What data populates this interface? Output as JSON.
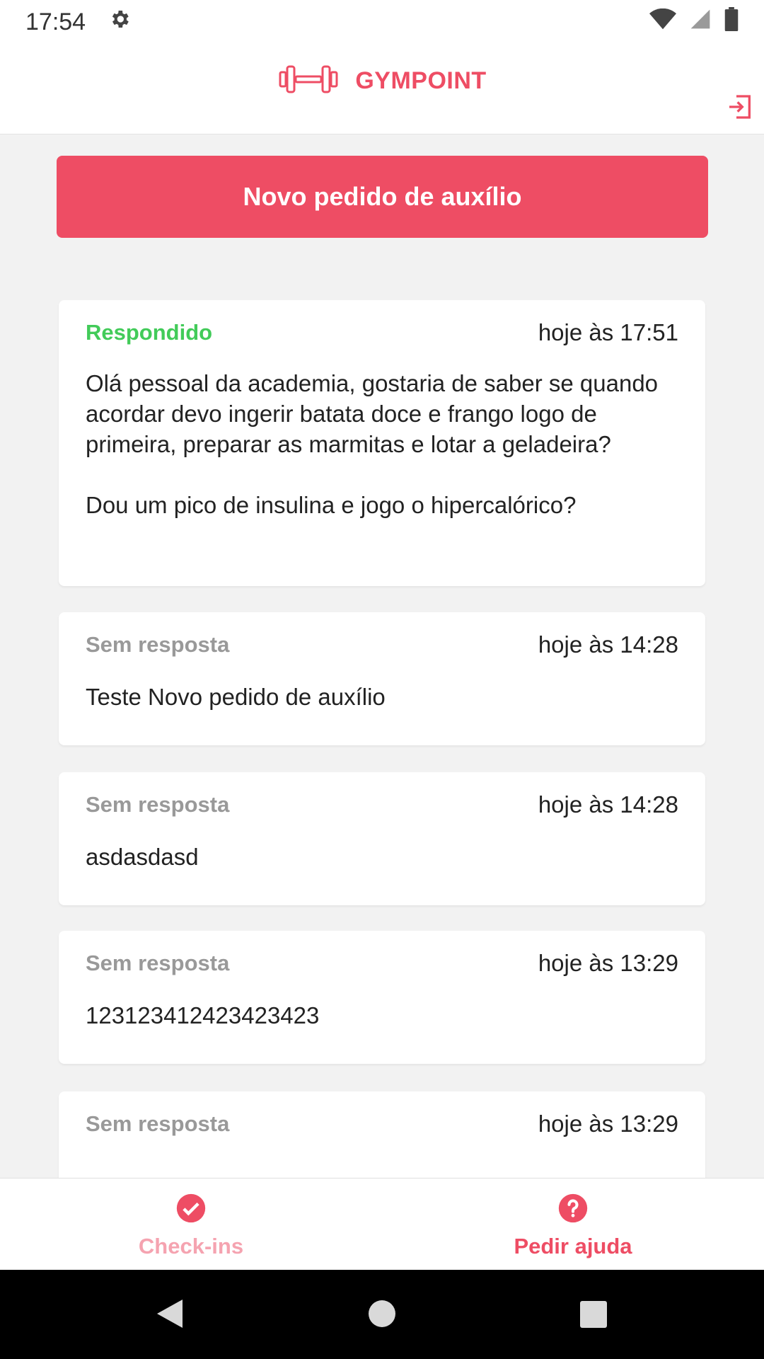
{
  "status_bar": {
    "time": "17:54",
    "icons": [
      "settings-icon",
      "wifi-icon",
      "signal-icon",
      "battery-icon"
    ]
  },
  "header": {
    "brand": "GYMPOINT",
    "logo_icon": "dumbbell-icon",
    "logout_icon": "logout-icon"
  },
  "actions": {
    "new_request": "Novo pedido de auxílio"
  },
  "requests": [
    {
      "status": "Respondido",
      "time": "hoje às 17:51",
      "question": "Olá pessoal da academia, gostaria de saber se quando acordar devo ingerir batata doce e frango logo de primeira, preparar as marmitas e lotar a geladeira?\n\nDou um pico de insulina e jogo o hipercalórico?"
    },
    {
      "status": "Sem resposta",
      "time": "hoje às 14:28",
      "question": "Teste Novo pedido de auxílio"
    },
    {
      "status": "Sem resposta",
      "time": "hoje às 14:28",
      "question": "asdasdasd"
    },
    {
      "status": "Sem resposta",
      "time": "hoje às 13:29",
      "question": "123123412423423423"
    },
    {
      "status": "Sem resposta",
      "time": "hoje às 13:29",
      "question": ""
    }
  ],
  "tabs": [
    {
      "label": "Check-ins",
      "icon": "check-circle-icon",
      "active": false
    },
    {
      "label": "Pedir ajuda",
      "icon": "help-circle-icon",
      "active": true
    }
  ],
  "colors": {
    "accent": "#ee4d64",
    "answered": "#42cb59",
    "unanswered": "#999999"
  }
}
